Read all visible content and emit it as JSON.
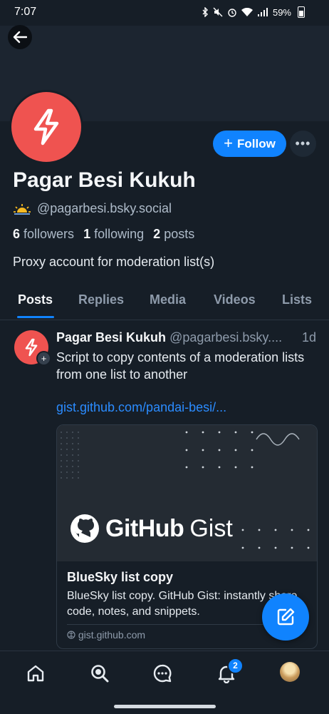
{
  "status_bar": {
    "time": "7:07",
    "battery": "59%"
  },
  "profile": {
    "follow_label": "Follow",
    "display_name": "Pagar Besi Kukuh",
    "handle": "@pagarbesi.bsky.social",
    "stats": {
      "followers_count": "6",
      "followers_label": "followers",
      "following_count": "1",
      "following_label": "following",
      "posts_count": "2",
      "posts_label": "posts"
    },
    "bio": "Proxy account for moderation list(s)"
  },
  "tabs": [
    {
      "label": "Posts",
      "active": true
    },
    {
      "label": "Replies",
      "active": false
    },
    {
      "label": "Media",
      "active": false
    },
    {
      "label": "Videos",
      "active": false
    },
    {
      "label": "Lists",
      "active": false
    }
  ],
  "post": {
    "author_name": "Pagar Besi Kukuh",
    "author_handle": "@pagarbesi.bsky....",
    "time": "1d",
    "text": "Script to copy contents of a moderation lists from one list to another",
    "link": "gist.github.com/pandai-besi/...",
    "card": {
      "logo_brand": "GitHub",
      "logo_product": "Gist",
      "title": "BlueSky list copy",
      "description": "BlueSky list copy. GitHub Gist: instantly share code, notes, and snippets.",
      "domain": "gist.github.com"
    }
  },
  "bottom_nav": {
    "items": [
      "home-icon",
      "search-icon",
      "chat-icon",
      "notifications-icon",
      "profile-avatar"
    ],
    "notification_badge": "2"
  },
  "colors": {
    "accent": "#1083fe",
    "avatar": "#ef5350",
    "background": "#161e27"
  }
}
